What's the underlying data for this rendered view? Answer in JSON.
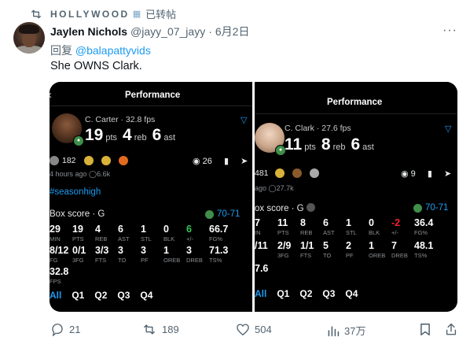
{
  "repost": {
    "account": "HOLLYWOOD",
    "label": "已转帖"
  },
  "tweet": {
    "author_name": "Jaylen Nichols",
    "author_handle": "@jayy_07_jayy",
    "separator": "·",
    "date": "6月2日",
    "reply_prefix": "回复",
    "reply_to": "@balapattyvids",
    "text": "She OWNS Clark."
  },
  "media": {
    "left": {
      "title": "Performance",
      "player": "C. Carter · 32.8 fps",
      "pts": "19",
      "reb": "4",
      "ast": "6",
      "pts_label": "pts",
      "reb_label": "reb",
      "ast_label": "ast",
      "reactions": "182",
      "action_count": "26",
      "time_meta": "4 hours ago",
      "views": "6.6k",
      "hashtag": "#seasonhigh",
      "box_label": "Box score · G",
      "score": "70-71",
      "row1": [
        {
          "v": "29",
          "l": "MIN"
        },
        {
          "v": "19",
          "l": "PTS"
        },
        {
          "v": "4",
          "l": "REB"
        },
        {
          "v": "6",
          "l": "AST"
        },
        {
          "v": "1",
          "l": "STL"
        },
        {
          "v": "0",
          "l": "BLK"
        },
        {
          "v": "6",
          "l": "+/-",
          "color": "green"
        },
        {
          "v": "66.7",
          "l": "FG%"
        }
      ],
      "row2": [
        {
          "v": "8/12",
          "l": "FG"
        },
        {
          "v": "0/1",
          "l": "3FG"
        },
        {
          "v": "3/3",
          "l": "FTS"
        },
        {
          "v": "3",
          "l": "TO"
        },
        {
          "v": "3",
          "l": "PF"
        },
        {
          "v": "1",
          "l": "OREB"
        },
        {
          "v": "3",
          "l": "DREB"
        },
        {
          "v": "71.3",
          "l": "TS%"
        }
      ],
      "row3": [
        {
          "v": "32.8",
          "l": "FPS"
        }
      ],
      "quarters": [
        "All",
        "Q1",
        "Q2",
        "Q3",
        "Q4"
      ]
    },
    "right": {
      "title": "Performance",
      "player": "C. Clark · 27.6 fps",
      "pts": "11",
      "reb": "8",
      "ast": "6",
      "pts_label": "pts",
      "reb_label": "reb",
      "ast_label": "ast",
      "reactions": "481",
      "action_count": "9",
      "time_meta": "ago",
      "views": "27.7k",
      "box_label": "ox score · G",
      "score": "70-71",
      "row1": [
        {
          "v": "7",
          "l": "IN"
        },
        {
          "v": "11",
          "l": "PTS"
        },
        {
          "v": "8",
          "l": "REB"
        },
        {
          "v": "6",
          "l": "AST"
        },
        {
          "v": "1",
          "l": "STL"
        },
        {
          "v": "0",
          "l": "BLK"
        },
        {
          "v": "-2",
          "l": "+/-",
          "color": "red"
        },
        {
          "v": "36.4",
          "l": "FG%"
        }
      ],
      "row2": [
        {
          "v": "/11",
          "l": ""
        },
        {
          "v": "2/9",
          "l": "3FG"
        },
        {
          "v": "1/1",
          "l": "FTS"
        },
        {
          "v": "5",
          "l": "TO"
        },
        {
          "v": "2",
          "l": "PF"
        },
        {
          "v": "1",
          "l": "OREB"
        },
        {
          "v": "7",
          "l": "DREB"
        },
        {
          "v": "48.1",
          "l": "TS%"
        }
      ],
      "row3": [
        {
          "v": "7.6",
          "l": ""
        }
      ],
      "quarters": [
        "All",
        "Q1",
        "Q2",
        "Q3",
        "Q4"
      ]
    }
  },
  "actions": {
    "replies": "21",
    "reposts": "189",
    "likes": "504",
    "views": "37万"
  },
  "colors": {
    "link": "#1d9bf0",
    "repost_green": "#00ba7c",
    "muted": "#536471"
  }
}
